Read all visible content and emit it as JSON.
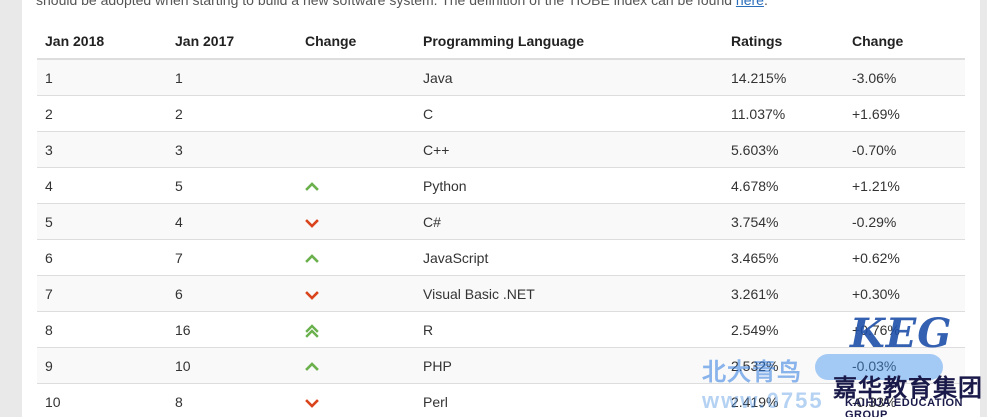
{
  "intro": {
    "text": "should be adopted when starting to build a new software system. The definition of the TIOBE index can be found ",
    "link_label": "here",
    "tail": "."
  },
  "table": {
    "headers": [
      "Jan 2018",
      "Jan 2017",
      "Change",
      "Programming Language",
      "Ratings",
      "Change"
    ],
    "rows": [
      {
        "rank_2018": "1",
        "rank_2017": "1",
        "trend": "none",
        "language": "Java",
        "rating": "14.215%",
        "change": "-3.06%"
      },
      {
        "rank_2018": "2",
        "rank_2017": "2",
        "trend": "none",
        "language": "C",
        "rating": "11.037%",
        "change": "+1.69%"
      },
      {
        "rank_2018": "3",
        "rank_2017": "3",
        "trend": "none",
        "language": "C++",
        "rating": "5.603%",
        "change": "-0.70%"
      },
      {
        "rank_2018": "4",
        "rank_2017": "5",
        "trend": "up",
        "language": "Python",
        "rating": "4.678%",
        "change": "+1.21%"
      },
      {
        "rank_2018": "5",
        "rank_2017": "4",
        "trend": "down",
        "language": "C#",
        "rating": "3.754%",
        "change": "-0.29%"
      },
      {
        "rank_2018": "6",
        "rank_2017": "7",
        "trend": "up",
        "language": "JavaScript",
        "rating": "3.465%",
        "change": "+0.62%"
      },
      {
        "rank_2018": "7",
        "rank_2017": "6",
        "trend": "down",
        "language": "Visual Basic .NET",
        "rating": "3.261%",
        "change": "+0.30%"
      },
      {
        "rank_2018": "8",
        "rank_2017": "16",
        "trend": "up-double",
        "language": "R",
        "rating": "2.549%",
        "change": "+0.76%"
      },
      {
        "rank_2018": "9",
        "rank_2017": "10",
        "trend": "up",
        "language": "PHP",
        "rating": "2.532%",
        "change": "-0.03%"
      },
      {
        "rank_2018": "10",
        "rank_2017": "8",
        "trend": "down",
        "language": "Perl",
        "rating": "2.419%",
        "change": "-0.33%"
      }
    ]
  },
  "colors": {
    "up": "#6ab04c",
    "down": "#d9441c"
  },
  "watermark": {
    "logo": "KEG",
    "cn_left": "北大青鸟",
    "cn_right": "嘉华教育集团",
    "url": "www.0755",
    "group": "KAIHUA EDUCATION GROUP"
  }
}
